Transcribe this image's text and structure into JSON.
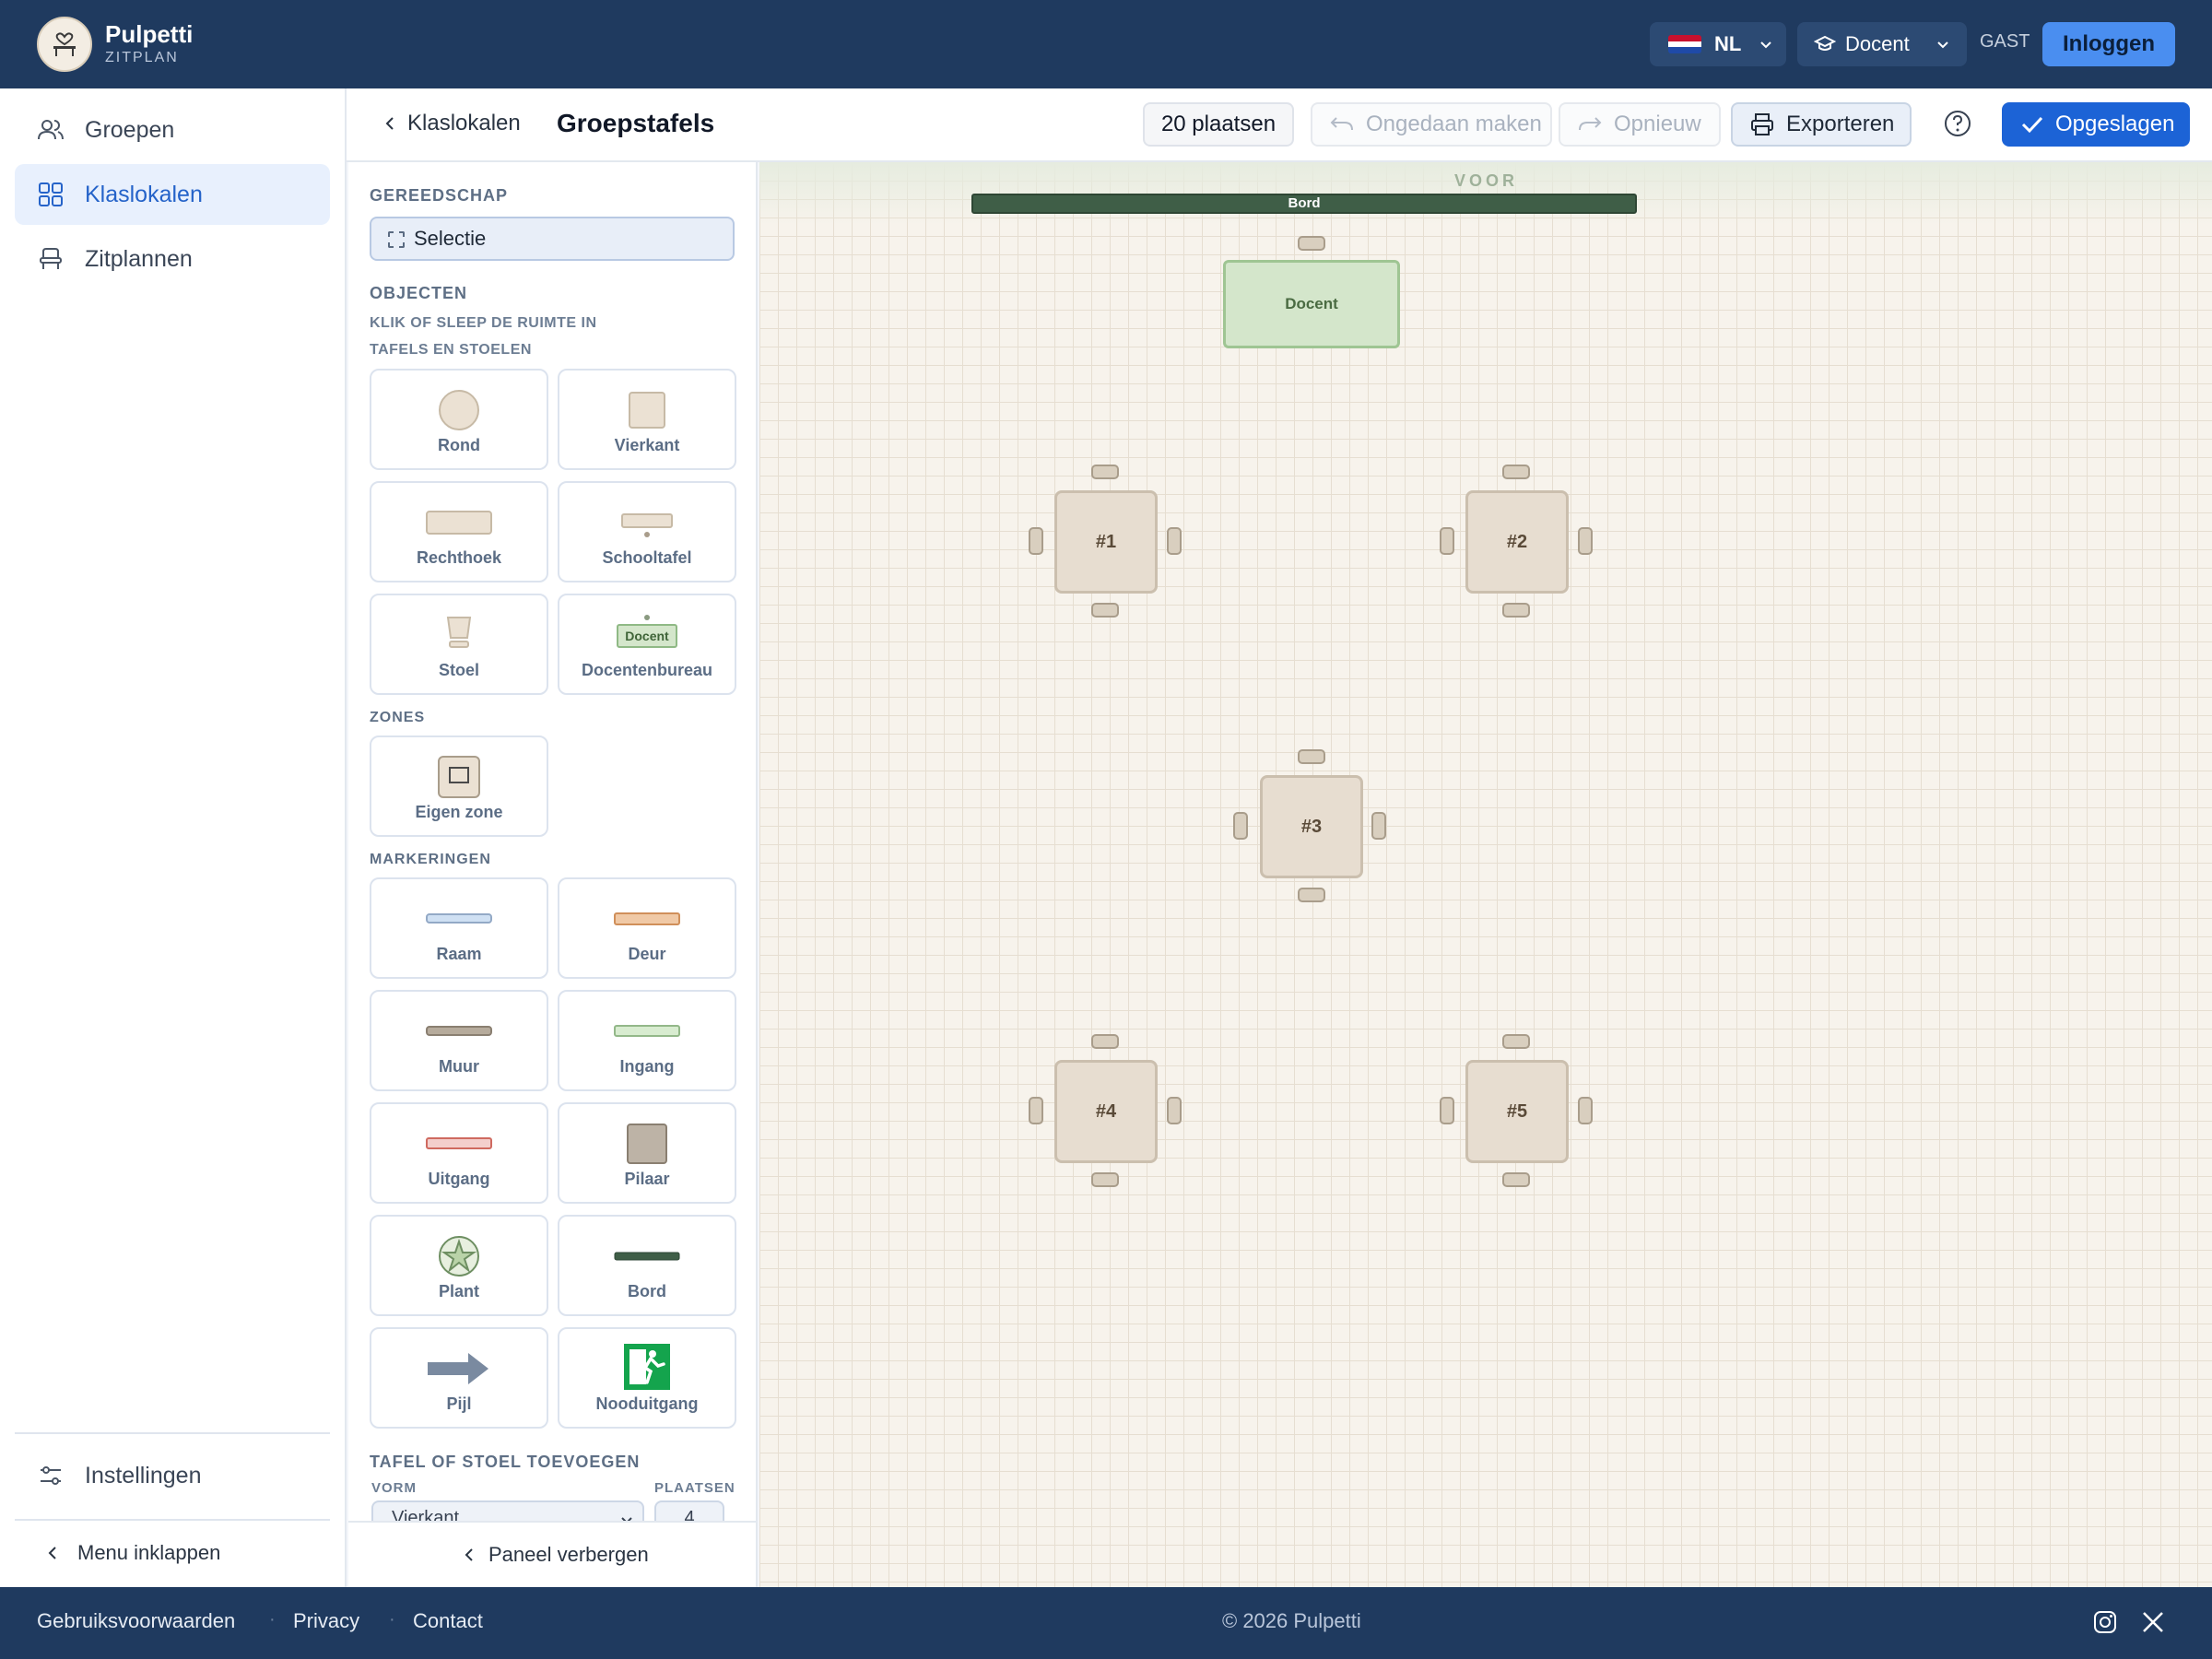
{
  "brand": {
    "name": "Pulpetti",
    "subtitle": "ZITPLAN"
  },
  "topbar": {
    "language": "NL",
    "role": "Docent",
    "guest_label": "GAST",
    "login_label": "Inloggen"
  },
  "nav": {
    "items": [
      {
        "label": "Groepen",
        "icon": "users-icon",
        "active": false
      },
      {
        "label": "Klaslokalen",
        "icon": "grid-icon",
        "active": true
      },
      {
        "label": "Zitplannen",
        "icon": "seat-icon",
        "active": false
      }
    ],
    "settings_label": "Instellingen",
    "collapse_label": "Menu inklappen"
  },
  "header": {
    "back_label": "Klaslokalen",
    "title": "Groepstafels",
    "seats": "20 plaatsen",
    "undo_label": "Ongedaan maken",
    "redo_label": "Opnieuw",
    "export_label": "Exporteren",
    "saved_label": "Opgeslagen"
  },
  "palette": {
    "tools_heading": "GEREEDSCHAP",
    "select_label": "Selectie",
    "objects_heading": "OBJECTEN",
    "objects_hint": "KLIK OF SLEEP DE RUIMTE IN",
    "tables_heading": "TAFELS EN STOELEN",
    "tables": [
      "Rond",
      "Vierkant",
      "Rechthoek",
      "Schooltafel",
      "Stoel",
      "Docentenbureau"
    ],
    "teacher_icon_text": "Docent",
    "zones_heading": "ZONES",
    "zones": [
      "Eigen zone"
    ],
    "markings_heading": "MARKERINGEN",
    "markings": [
      "Raam",
      "Deur",
      "Muur",
      "Ingang",
      "Uitgang",
      "Pilaar",
      "Plant",
      "Bord",
      "Pijl",
      "Nooduitgang"
    ],
    "add_heading": "TAFEL OF STOEL TOEVOEGEN",
    "shape_label": "VORM",
    "seats_label": "PLAATSEN",
    "shape_value": "Vierkant",
    "seats_value": "4",
    "hide_label": "Paneel verbergen"
  },
  "canvas": {
    "front_label": "VOOR",
    "board_label": "Bord",
    "teacher_desk_label": "Docent",
    "tables": [
      "#1",
      "#2",
      "#3",
      "#4",
      "#5"
    ]
  },
  "footer": {
    "links": [
      "Gebruiksvoorwaarden",
      "Privacy",
      "Contact"
    ],
    "copyright": "© 2026 Pulpetti"
  },
  "colors": {
    "topbar": "#1f3a5f",
    "accent": "#1c63d6",
    "board": "#3f5e47",
    "desk": "#d4e6cb",
    "table": "#e7ddd0"
  }
}
